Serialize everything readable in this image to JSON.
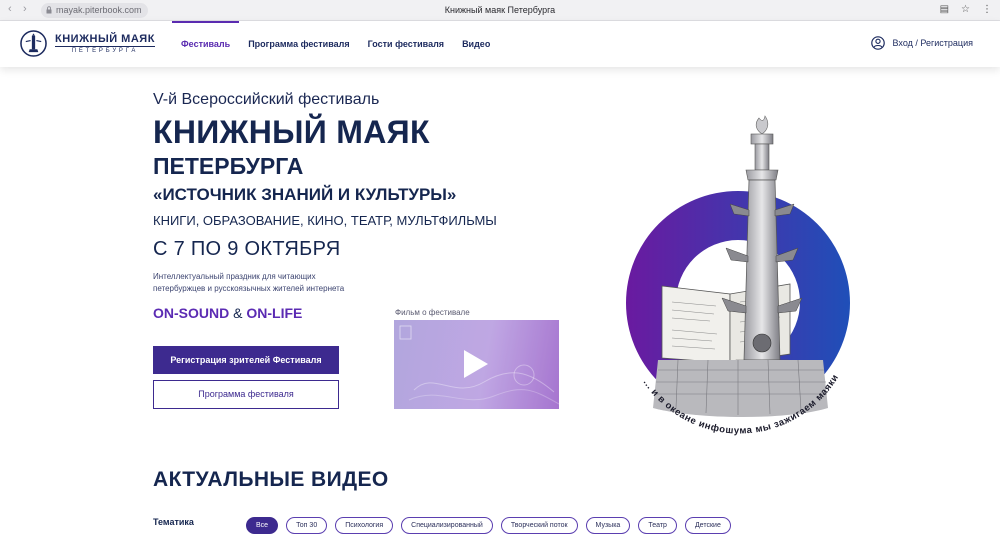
{
  "browser": {
    "url": "mayak.piterbook.com",
    "tab_title": "Книжный маяк Петербурга"
  },
  "header": {
    "logo_title": "КНИЖНЫЙ МАЯК",
    "logo_subtitle": "ПЕТЕРБУРГА",
    "nav": [
      {
        "label": "Фестиваль",
        "active": true
      },
      {
        "label": "Программа фестиваля",
        "active": false
      },
      {
        "label": "Гости фестиваля",
        "active": false
      },
      {
        "label": "Видео",
        "active": false
      }
    ],
    "login_label": "Вход / Регистрация"
  },
  "hero": {
    "pre_title": "V-й Всероссийский фестиваль",
    "title": "КНИЖНЫЙ МАЯК",
    "city": "ПЕТЕРБУРГА",
    "theme": "«ИСТОЧНИК ЗНАНИЙ И КУЛЬТУРЫ»",
    "topics": "КНИГИ, ОБРАЗОВАНИЕ, КИНО, ТЕАТР, МУЛЬТФИЛЬМЫ",
    "dates": "С 7 ПО 9 ОКТЯБРЯ",
    "description_line1": "Интеллектуальный праздник для читающих",
    "description_line2": "петербуржцев и русскоязычных жителей интернета",
    "sound_a": "ON-SOUND",
    "sound_amp": "&",
    "sound_b": "ON-LIFE",
    "register_button": "Регистрация зрителей Фестиваля",
    "program_button": "Программа фестиваля",
    "video_label": "Фильм о фестивале",
    "art_caption": "... и в океане инфошума мы зажигаем маяки"
  },
  "videos": {
    "title": "АКТУАЛЬНЫЕ ВИДЕО",
    "filter_label": "Тематика",
    "chips": [
      {
        "label": "Все",
        "active": true
      },
      {
        "label": "Топ 30",
        "active": false
      },
      {
        "label": "Психология",
        "active": false
      },
      {
        "label": "Специализированный",
        "active": false
      },
      {
        "label": "Творческий поток",
        "active": false
      },
      {
        "label": "Музыка",
        "active": false
      },
      {
        "label": "Театр",
        "active": false
      },
      {
        "label": "Детские",
        "active": false
      }
    ]
  },
  "colors": {
    "brand_navy": "#15264f",
    "accent_purple": "#3d2a8f",
    "ring_start": "#6a1aa0",
    "ring_end": "#1f4fb8"
  },
  "icons": [
    "lock-icon",
    "user-icon",
    "play-icon",
    "lighthouse-logo-icon"
  ]
}
